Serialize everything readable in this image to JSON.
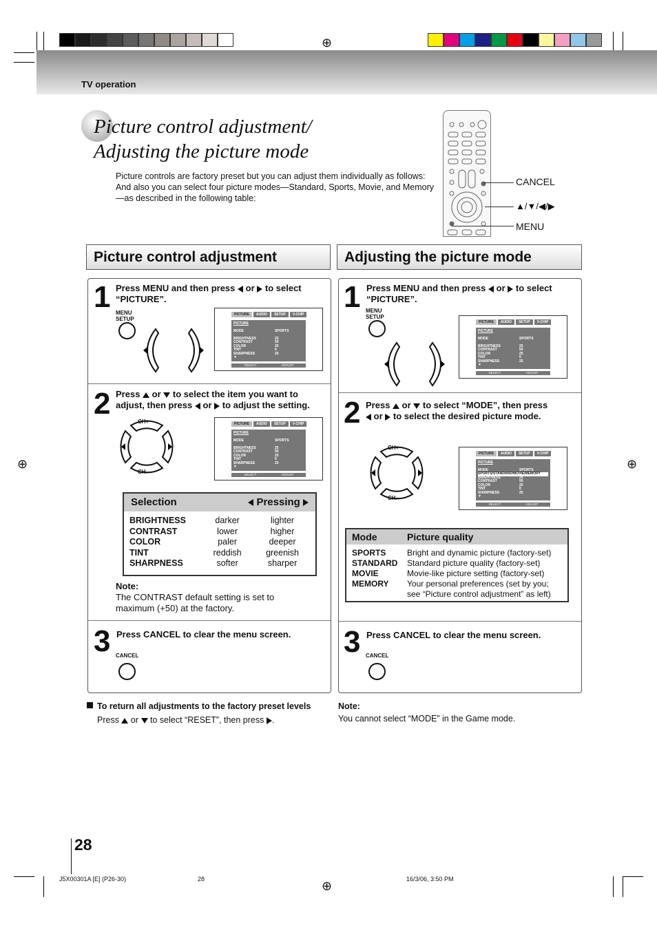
{
  "header": {
    "section": "TV operation",
    "page_number": "28"
  },
  "colors": {
    "gray_bars": [
      "#000000",
      "#1a1a1a",
      "#2e2e2e",
      "#444444",
      "#5c5c5c",
      "#777777",
      "#928a84",
      "#aaa49f",
      "#c4bdb9",
      "#dedad8",
      "#ffffff"
    ],
    "color_bars": [
      "#ffef00",
      "#e6007e",
      "#00a0e9",
      "#1d2088",
      "#009944",
      "#e60012",
      "#000000",
      "#fff799",
      "#f5a0c0",
      "#90c8ec",
      "#999999"
    ]
  },
  "title": {
    "line1": "Picture control adjustment/",
    "line2": "Adjusting the picture mode"
  },
  "intro": "Picture controls are factory preset but you can adjust them individually as follows: And also you can select four picture modes—Standard, Sports, Movie, and Memory—as described in the following table:",
  "remote": {
    "cancel": "CANCEL",
    "arrows": "▲/▼/◀/▶",
    "menu": "MENU"
  },
  "menu": {
    "tabs": [
      "PICTURE",
      "AUDIO",
      "SETUP",
      "V-CHIP"
    ],
    "heading": "PICTURE",
    "mode_label": "MODE",
    "mode_value": "SPORTS",
    "mode_options": "SPORTS/STANDARD/MOVIE/MEMORY",
    "items": [
      {
        "n": "BRIGHTNESS",
        "v": "25"
      },
      {
        "n": "CONTRAST",
        "v": "50"
      },
      {
        "n": "COLOR",
        "v": "25"
      },
      {
        "n": "TINT",
        "v": "0"
      },
      {
        "n": "SHARPNESS",
        "v": "25"
      }
    ],
    "select": ":SELECT",
    "adjust": ":ADJUST"
  },
  "left": {
    "heading": "Picture control adjustment",
    "step1": {
      "num": "1",
      "a": "Press MENU and then press",
      "or": "or",
      "b": "to select",
      "c": "“PICTURE”.",
      "btn": "MENU\nSETUP"
    },
    "step2": {
      "num": "2",
      "a": "Press",
      "or": "or",
      "b": "to select the item you want to",
      "c": "adjust, then press",
      "d": "or",
      "e": "to adjust the setting.",
      "ch_up": "CH+",
      "ch_down": "CH–"
    },
    "table": {
      "col1": "Selection",
      "col2": "Pressing",
      "rows": [
        [
          "BRIGHTNESS",
          "darker",
          "lighter"
        ],
        [
          "CONTRAST",
          "lower",
          "higher"
        ],
        [
          "COLOR",
          "paler",
          "deeper"
        ],
        [
          "TINT",
          "reddish",
          "greenish"
        ],
        [
          "SHARPNESS",
          "softer",
          "sharper"
        ]
      ]
    },
    "note_title": "Note:",
    "note": "The CONTRAST default setting is set to maximum (+50) at the factory.",
    "step3": {
      "num": "3",
      "text": "Press CANCEL to clear the menu screen.",
      "btn": "CANCEL"
    },
    "reset_title": "To return all adjustments to the factory preset levels",
    "reset": {
      "a": "Press",
      "or": "or",
      "b": "to select “RESET”, then press",
      "c": "."
    }
  },
  "right": {
    "heading": "Adjusting the picture mode",
    "step1": {
      "num": "1",
      "a": "Press MENU and then press",
      "or": "or",
      "b": "to select",
      "c": "“PICTURE”.",
      "btn": "MENU\nSETUP"
    },
    "step2": {
      "num": "2",
      "a": "Press",
      "or": "or",
      "b": "to select “MODE”, then press",
      "d": "or",
      "e": "to select the desired picture mode.",
      "ch_up": "CH+",
      "ch_down": "CH–"
    },
    "table": {
      "col1": "Mode",
      "col2": "Picture quality",
      "rows": [
        [
          "SPORTS",
          "Bright and dynamic picture (factory-set)"
        ],
        [
          "STANDARD",
          "Standard picture quality (factory-set)"
        ],
        [
          "MOVIE",
          "Movie-like picture setting (factory-set)"
        ],
        [
          "MEMORY",
          "Your personal preferences (set by you; see “Picture control adjustment” as left)"
        ]
      ]
    },
    "step3": {
      "num": "3",
      "text": "Press CANCEL to clear the menu screen.",
      "btn": "CANCEL"
    },
    "note_title": "Note:",
    "note": "You cannot select “MODE” in the Game mode."
  },
  "footer": {
    "code": "J5X00301A [E] (P26-30)",
    "page": "28",
    "date": "16/3/06, 3:50 PM"
  }
}
